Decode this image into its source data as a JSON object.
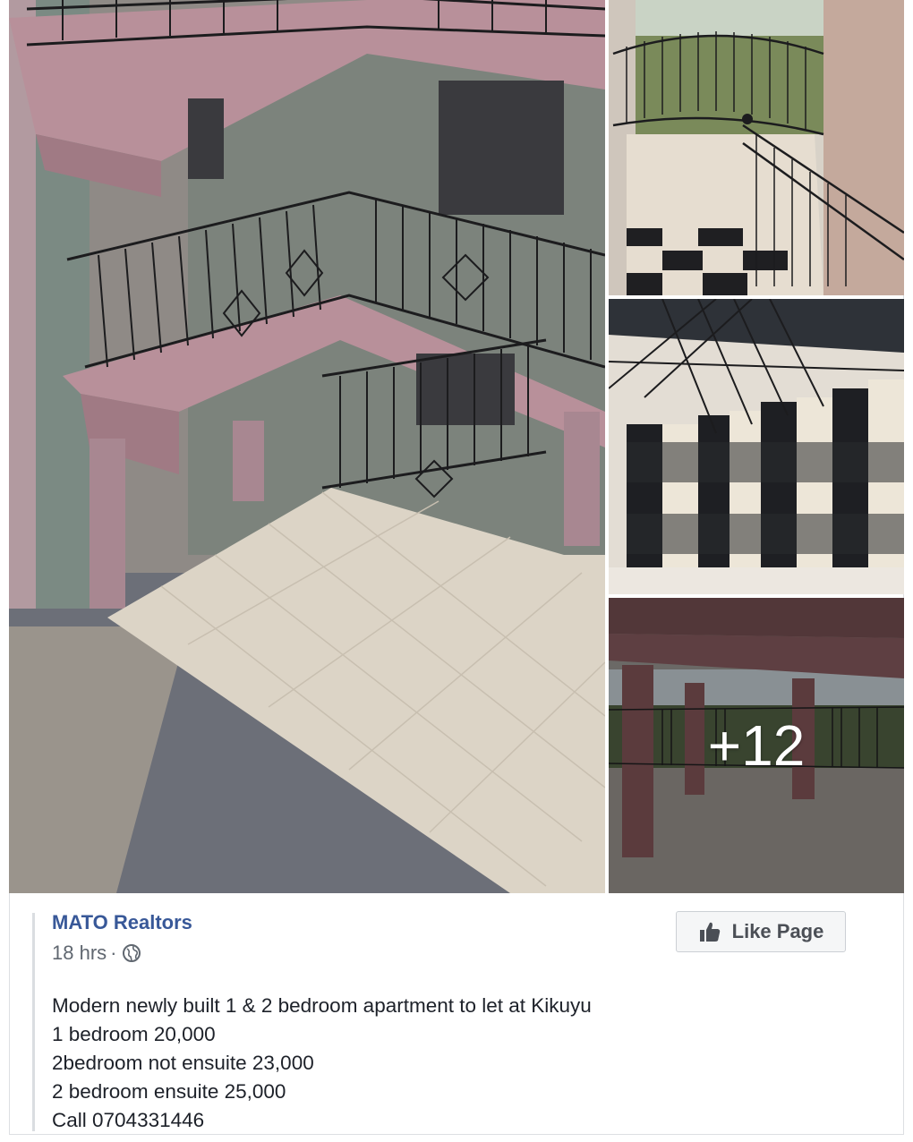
{
  "post": {
    "page_name": "MATO Realtors",
    "time": "18 hrs",
    "separator": "·",
    "audience_icon": "globe-icon",
    "like_button_label": "Like Page",
    "like_icon": "thumbs-up-icon",
    "text_lines": [
      "Modern newly built 1 & 2 bedroom apartment to let at Kikuyu",
      "1 bedroom 20,000",
      "2bedroom not ensuite 23,000",
      "2 bedroom ensuite 25,000",
      "Call 0704331446"
    ]
  },
  "gallery": {
    "more_count": "+12"
  },
  "colors": {
    "link": "#385898",
    "text": "#1d2129",
    "meta": "#606770",
    "wall_pink": "#b8909a"
  }
}
